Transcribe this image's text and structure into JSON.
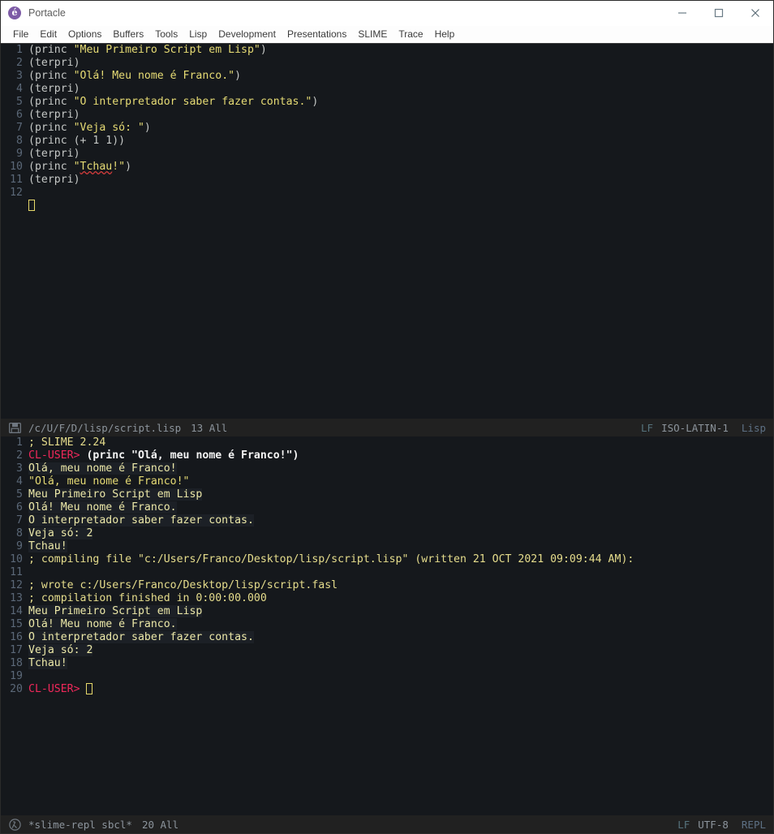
{
  "window": {
    "title": "Portacle",
    "app_icon": "portacle-logo-icon",
    "controls": [
      {
        "name": "minimize-button",
        "glyph": "minimize-icon"
      },
      {
        "name": "maximize-button",
        "glyph": "maximize-icon"
      },
      {
        "name": "close-button",
        "glyph": "close-icon"
      }
    ]
  },
  "menubar": {
    "items": [
      {
        "label": "File"
      },
      {
        "label": "Edit"
      },
      {
        "label": "Options"
      },
      {
        "label": "Buffers"
      },
      {
        "label": "Tools"
      },
      {
        "label": "Lisp"
      },
      {
        "label": "Development"
      },
      {
        "label": "Presentations"
      },
      {
        "label": "SLIME"
      },
      {
        "label": "Trace"
      },
      {
        "label": "Help"
      }
    ]
  },
  "editor": {
    "lines": [
      {
        "n": "1",
        "segments": [
          {
            "t": "(princ ",
            "c": "c-code"
          },
          {
            "t": "\"Meu Primeiro Script em Lisp\"",
            "c": "c-str"
          },
          {
            "t": ")",
            "c": "c-code"
          }
        ]
      },
      {
        "n": "2",
        "segments": [
          {
            "t": "(terpri)",
            "c": "c-code"
          }
        ]
      },
      {
        "n": "3",
        "segments": [
          {
            "t": "(princ ",
            "c": "c-code"
          },
          {
            "t": "\"Olá! Meu nome é Franco.\"",
            "c": "c-str"
          },
          {
            "t": ")",
            "c": "c-code"
          }
        ]
      },
      {
        "n": "4",
        "segments": [
          {
            "t": "(terpri)",
            "c": "c-code"
          }
        ]
      },
      {
        "n": "5",
        "segments": [
          {
            "t": "(princ ",
            "c": "c-code"
          },
          {
            "t": "\"O interpretador saber fazer contas.\"",
            "c": "c-str"
          },
          {
            "t": ")",
            "c": "c-code"
          }
        ]
      },
      {
        "n": "6",
        "segments": [
          {
            "t": "(terpri)",
            "c": "c-code"
          }
        ]
      },
      {
        "n": "7",
        "segments": [
          {
            "t": "(princ ",
            "c": "c-code"
          },
          {
            "t": "\"Veja só: \"",
            "c": "c-str"
          },
          {
            "t": ")",
            "c": "c-code"
          }
        ]
      },
      {
        "n": "8",
        "segments": [
          {
            "t": "(princ (+ 1 1))",
            "c": "c-code"
          }
        ]
      },
      {
        "n": "9",
        "segments": [
          {
            "t": "(terpri)",
            "c": "c-code"
          }
        ]
      },
      {
        "n": "10",
        "segments": [
          {
            "t": "(princ ",
            "c": "c-code"
          },
          {
            "t": "\"",
            "c": "c-str"
          },
          {
            "t": "Tchau",
            "c": "c-str misspell"
          },
          {
            "t": "!\"",
            "c": "c-str"
          },
          {
            "t": ")",
            "c": "c-code"
          }
        ]
      },
      {
        "n": "11",
        "segments": [
          {
            "t": "(terpri)",
            "c": "c-code"
          }
        ]
      },
      {
        "n": "12",
        "segments": []
      },
      {
        "n": "",
        "segments": [],
        "cursor": true
      }
    ]
  },
  "editor_modeline": {
    "icon": "saved-file-icon",
    "file": "/c/U/F/D/lisp/script.lisp",
    "position": "13 All",
    "eol": "LF",
    "encoding": "ISO-LATIN-1",
    "major_mode": "Lisp"
  },
  "repl": {
    "lines": [
      {
        "n": "1",
        "segments": [
          {
            "t": "; SLIME 2.24",
            "c": "c-comment"
          }
        ]
      },
      {
        "n": "2",
        "segments": [
          {
            "t": "CL-USER> ",
            "c": "c-prompt"
          },
          {
            "t": "(princ \"Olá, meu nome é Franco!\")",
            "c": "c-input"
          }
        ]
      },
      {
        "n": "3",
        "segments": [
          {
            "t": "Olá, meu nome é Franco!",
            "c": "c-out hl-out"
          }
        ]
      },
      {
        "n": "4",
        "segments": [
          {
            "t": "\"Olá, meu nome é Franco!\"",
            "c": "c-str"
          }
        ]
      },
      {
        "n": "5",
        "segments": [
          {
            "t": "Meu Primeiro Script em Lisp",
            "c": "c-out hl-out"
          }
        ]
      },
      {
        "n": "6",
        "segments": [
          {
            "t": "Olá! Meu nome é Franco.",
            "c": "c-out hl-out"
          }
        ]
      },
      {
        "n": "7",
        "segments": [
          {
            "t": "O interpretador saber fazer contas.",
            "c": "c-out hl-out"
          }
        ]
      },
      {
        "n": "8",
        "segments": [
          {
            "t": "Veja só: 2",
            "c": "c-out hl-out"
          }
        ]
      },
      {
        "n": "9",
        "segments": [
          {
            "t": "Tchau!",
            "c": "c-out hl-out"
          }
        ]
      },
      {
        "n": "10",
        "segments": [
          {
            "t": "; compiling file \"c:/Users/Franco/Desktop/lisp/script.lisp\" (written 21 OCT 2021 09:09:44 AM):",
            "c": "c-comment"
          }
        ]
      },
      {
        "n": "11",
        "segments": []
      },
      {
        "n": "12",
        "segments": [
          {
            "t": "; wrote c:/Users/Franco/Desktop/lisp/script.fasl",
            "c": "c-comment"
          }
        ]
      },
      {
        "n": "13",
        "segments": [
          {
            "t": "; compilation finished in 0:00:00.000",
            "c": "c-comment"
          }
        ]
      },
      {
        "n": "14",
        "segments": [
          {
            "t": "Meu Primeiro Script em Lisp",
            "c": "c-out hl-out"
          }
        ]
      },
      {
        "n": "15",
        "segments": [
          {
            "t": "Olá! Meu nome é Franco.",
            "c": "c-out hl-out"
          }
        ]
      },
      {
        "n": "16",
        "segments": [
          {
            "t": "O interpretador saber fazer contas.",
            "c": "c-out hl-out"
          }
        ]
      },
      {
        "n": "17",
        "segments": [
          {
            "t": "Veja só: 2",
            "c": "c-out hl-out"
          }
        ]
      },
      {
        "n": "18",
        "segments": [
          {
            "t": "Tchau!",
            "c": "c-out hl-out"
          }
        ]
      },
      {
        "n": "19",
        "segments": []
      },
      {
        "n": "20",
        "segments": [
          {
            "t": "CL-USER> ",
            "c": "c-prompt"
          }
        ],
        "cursor": true
      }
    ]
  },
  "repl_modeline": {
    "icon": "lisp-lambda-icon",
    "buffer": "*slime-repl sbcl*",
    "position": "20 All",
    "eol": "LF",
    "encoding": "UTF-8",
    "major_mode": "REPL"
  },
  "colors": {
    "background": "#15181c",
    "modeline_bg": "#212121",
    "string": "#e6db74",
    "comment": "#e6dd8c",
    "prompt": "#f0285a",
    "linenumber": "#5b6878",
    "cursor": "#e7d96b",
    "titlebar_bg": "#ffffff",
    "accent": "#7d5ba6"
  }
}
